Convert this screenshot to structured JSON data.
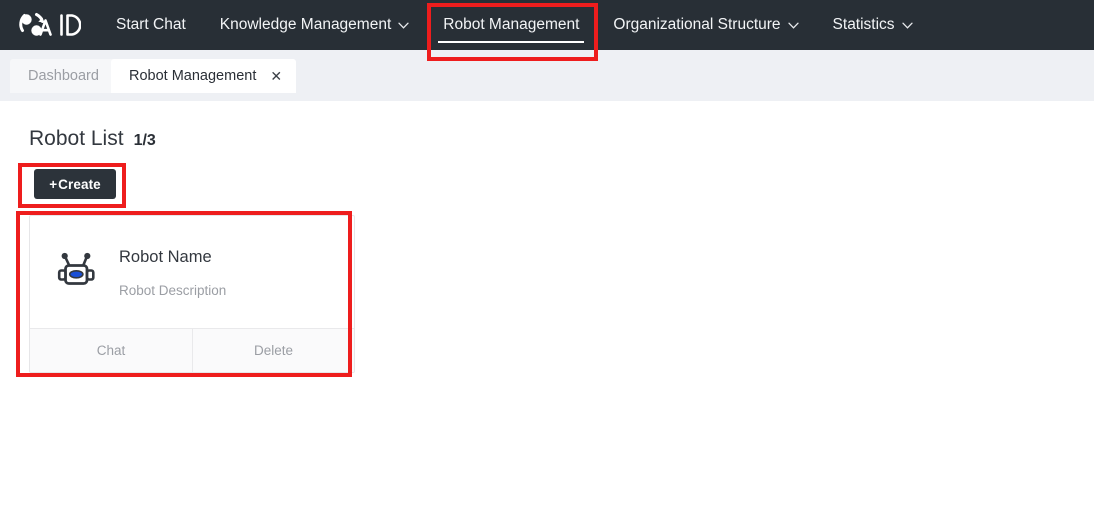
{
  "header": {
    "logo": {
      "icon_name": "aid-circular-logo-icon",
      "wordmark": "AID"
    },
    "nav": [
      {
        "label": "Start Chat",
        "has_caret": false,
        "active": false
      },
      {
        "label": "Knowledge Management",
        "has_caret": true,
        "caret": "∨",
        "active": false
      },
      {
        "label": "Robot Management",
        "has_caret": false,
        "active": true
      },
      {
        "label": "Organizational Structure",
        "has_caret": true,
        "caret": "∨",
        "active": false
      },
      {
        "label": "Statistics",
        "has_caret": true,
        "caret": "∨",
        "active": false
      }
    ]
  },
  "tabs": [
    {
      "label": "Dashboard",
      "active": false,
      "closable": false
    },
    {
      "label": "Robot Management",
      "active": true,
      "closable": true,
      "close_glyph": "✕"
    }
  ],
  "main": {
    "title": "Robot List",
    "count": "1/3",
    "create_button": {
      "plus": "+",
      "label": "Create"
    },
    "robot_card": {
      "icon_name": "robot-head-icon",
      "name": "Robot Name",
      "description": "Robot Description",
      "actions": [
        {
          "label": "Chat"
        },
        {
          "label": "Delete"
        }
      ]
    }
  },
  "annotations": [
    {
      "name": "nav-robot-management-highlight",
      "color": "#ee1d1d"
    },
    {
      "name": "create-button-highlight",
      "color": "#ee1d1d"
    },
    {
      "name": "robot-card-highlight",
      "color": "#ee1d1d"
    }
  ],
  "colors": {
    "header_bg": "#282f36",
    "tabstrip_bg": "#eef0f4",
    "annotation_red": "#ee1d1d",
    "robot_visor_blue": "#1a4fd6",
    "button_dark": "#2c333a"
  }
}
